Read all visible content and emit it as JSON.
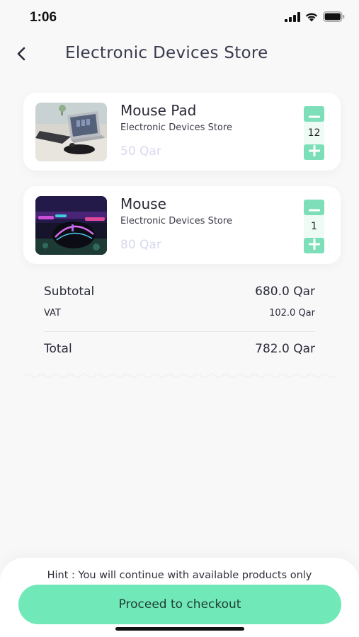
{
  "status_bar": {
    "time": "1:06",
    "icons": [
      "signal-icon",
      "wifi-icon",
      "battery-icon"
    ]
  },
  "header": {
    "title": "Electronic Devices Store",
    "back_icon": "chevron-left-icon"
  },
  "cart_items": [
    {
      "name": "Mouse Pad",
      "store": "Electronic Devices Store",
      "price": "50 Qar",
      "quantity": "12",
      "image": "mouse-pad-photo"
    },
    {
      "name": "Mouse",
      "store": "Electronic Devices Store",
      "price": "80 Qar",
      "quantity": "1",
      "image": "gaming-mouse-photo"
    }
  ],
  "summary": {
    "subtotal_label": "Subtotal",
    "subtotal_value": "680.0 Qar",
    "vat_label": "VAT",
    "vat_value": "102.0 Qar",
    "total_label": "Total",
    "total_value": "782.0 Qar"
  },
  "footer": {
    "hint": "Hint : You will continue with available products only",
    "checkout_label": "Proceed to checkout"
  },
  "colors": {
    "accent": "#71e8b8",
    "qty_button": "#7ddfb9",
    "price_text": "#d8d8f0",
    "background": "#f8f8f9"
  }
}
